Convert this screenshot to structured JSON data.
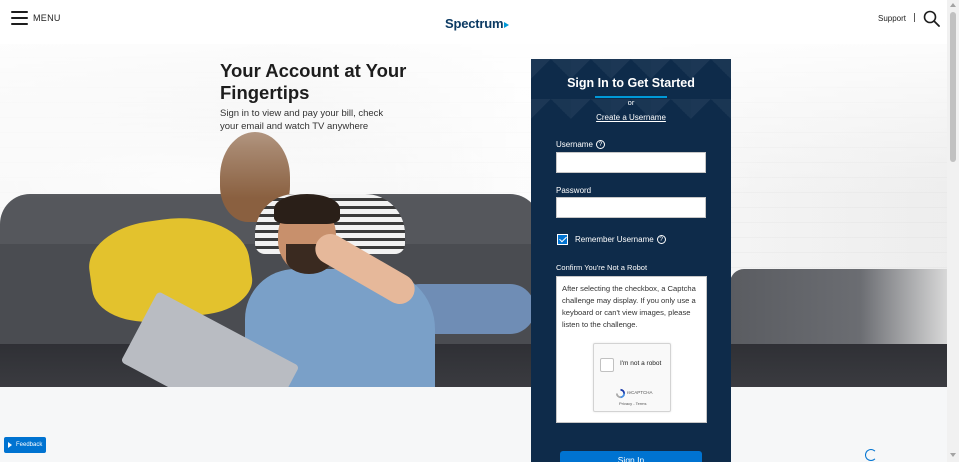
{
  "header": {
    "menu_label": "MENU",
    "logo_text": "Spectrum",
    "support_label": "Support",
    "divider": "|"
  },
  "hero": {
    "title": "Your Account at Your Fingertips",
    "subtitle": "Sign in to view and pay your bill, check your email and watch TV anywhere"
  },
  "signin": {
    "title": "Sign In to Get Started",
    "or_text": "or",
    "create_link": "Create a Username",
    "username_label": "Username",
    "username_value": "",
    "password_label": "Password",
    "password_value": "",
    "remember_label": "Remember Username",
    "remember_checked": true,
    "robot_label": "Confirm You're Not a Robot",
    "captcha_text": "After selecting the checkbox, a Captcha challenge may display. If you only use a keyboard or can't view images, please listen to the challenge.",
    "recaptcha_label": "I'm not a robot",
    "recaptcha_brand": "reCAPTCHA",
    "recaptcha_terms": "Privacy - Terms",
    "signin_button": "Sign In"
  },
  "feedback": {
    "label": "Feedback"
  },
  "colors": {
    "brand_navy": "#0e2b4a",
    "brand_blue": "#0073d1",
    "logo_blue": "#0b3a63",
    "accent": "#0099d8"
  },
  "icons": {
    "menu": "hamburger-icon",
    "search": "search-icon",
    "help": "question-circle-icon",
    "feedback": "play-arrow-icon"
  }
}
